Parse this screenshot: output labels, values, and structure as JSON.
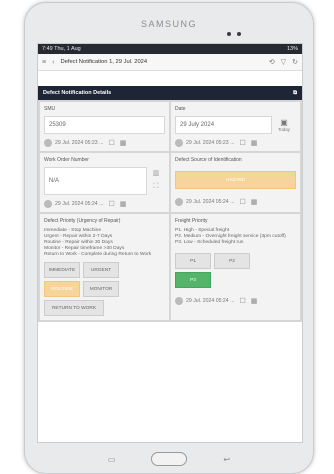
{
  "device": {
    "brand": "SAMSUNG"
  },
  "status": {
    "left": "7:49  Thu, 1 Aug",
    "right": "13%"
  },
  "appbar": {
    "title": "Defect Notification 1, 29 Jul. 2024"
  },
  "section": {
    "title": "Defect Notification Details"
  },
  "smu": {
    "label": "SMU",
    "value": "25309",
    "meta": "29 Jul. 2024 05:23 ..."
  },
  "date": {
    "label": "Date",
    "value": "29 July 2024",
    "today": "Today",
    "meta": "29 Jul. 2024 05:23 ..."
  },
  "work_order": {
    "label": "Work Order Number",
    "value": "N/A",
    "meta": "29 Jul. 2024 05:24 ..."
  },
  "defect_source": {
    "label": "Defect Source of Identification",
    "value": "HAZARD",
    "meta": "29 Jul. 2024 05:24 ..."
  },
  "defect_priority": {
    "label": "Defect Priority (Urgency of Repair)",
    "desc": [
      "Immediate - Stop Machine",
      "Urgent - Repair within 2-7 Days",
      "Routine - Repair within 30 Days",
      "Monitor - Repair timeframe >30 Days",
      "Return to Work - Complete during Return to Work"
    ],
    "buttons": [
      "IMMEDIATE",
      "URGENT",
      "ROUTINE",
      "MONITOR",
      "RETURN TO WORK"
    ],
    "selected": "ROUTINE",
    "selected_color": "#f6d59b"
  },
  "freight_priority": {
    "label": "Freight Priority",
    "desc": [
      "P1. High - Special freight",
      "P2. Medium - Overnight freight service (3pm cutoff)",
      "P3. Low - Scheduled freight run"
    ],
    "buttons": [
      "P1",
      "P2",
      "P3"
    ],
    "selected": "P3",
    "selected_color": "#53b46a",
    "meta": "29 Jul. 2024 05:24 ..."
  }
}
